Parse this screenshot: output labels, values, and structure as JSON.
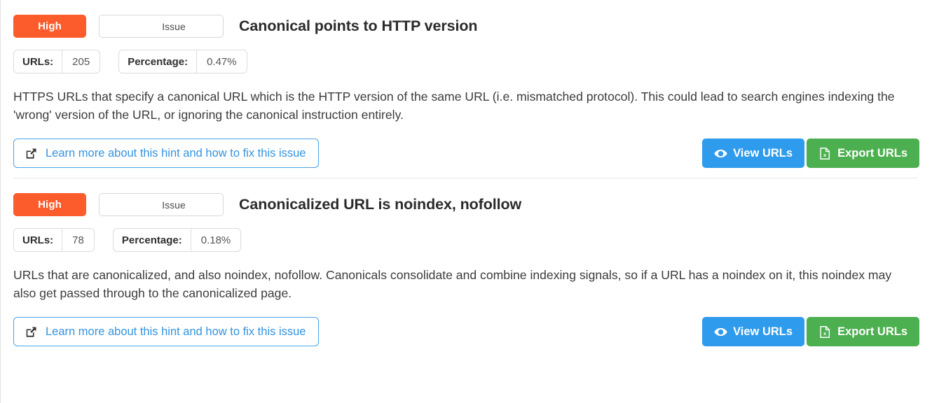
{
  "hints": [
    {
      "severity": "High",
      "type": "Issue",
      "title": "Canonical points to HTTP version",
      "metrics": {
        "urls_label": "URLs:",
        "urls_value": "205",
        "percentage_label": "Percentage:",
        "percentage_value": "0.47%"
      },
      "description": "HTTPS URLs that specify a canonical URL which is the HTTP version of the same URL (i.e. mismatched protocol). This could lead to search engines indexing the 'wrong' version of the URL, or ignoring the canonical instruction entirely.",
      "learn_more_label": "Learn more about this hint and how to fix this issue",
      "view_label": "View URLs",
      "export_label": "Export URLs"
    },
    {
      "severity": "High",
      "type": "Issue",
      "title": "Canonicalized URL is noindex, nofollow",
      "metrics": {
        "urls_label": "URLs:",
        "urls_value": "78",
        "percentage_label": "Percentage:",
        "percentage_value": "0.18%"
      },
      "description": "URLs that are canonicalized, and also noindex, nofollow. Canonicals consolidate and combine indexing signals, so if a URL has a noindex on it, this noindex may also get passed through to the canonicalized page.",
      "learn_more_label": "Learn more about this hint and how to fix this issue",
      "view_label": "View URLs",
      "export_label": "Export URLs"
    }
  ],
  "icons": {
    "external_link": "external-link-icon",
    "eye": "eye-icon",
    "file_excel": "file-excel-icon"
  },
  "colors": {
    "severity_high": "#fc5b2b",
    "view_button": "#2e9bec",
    "export_button": "#4caf50",
    "link_blue": "#3494e0"
  }
}
